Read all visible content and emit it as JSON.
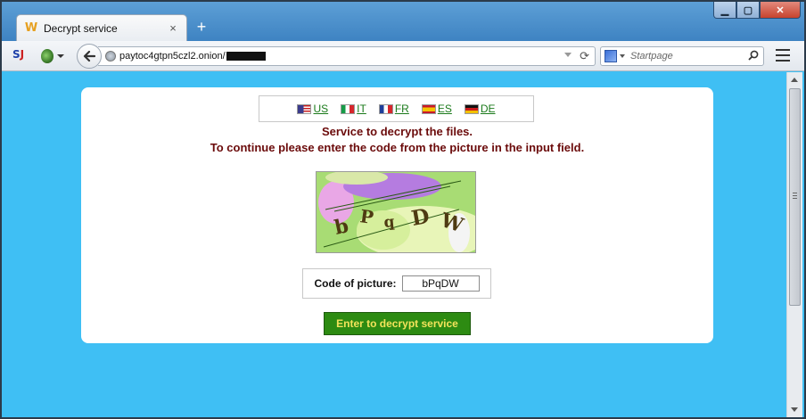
{
  "browser": {
    "tab_title": "Decrypt service",
    "url_text": "paytoc4gtpn5czl2.onion/",
    "search_placeholder": "Startpage",
    "window_controls": {
      "minimize": "▁",
      "maximize": "▢",
      "close": "✕"
    },
    "new_tab": "+",
    "tab_close": "×"
  },
  "languages": [
    {
      "code": "US",
      "flag": "us-flag-icon"
    },
    {
      "code": "IT",
      "flag": "it-flag-icon"
    },
    {
      "code": "FR",
      "flag": "fr-flag-icon"
    },
    {
      "code": "ES",
      "flag": "es-flag-icon"
    },
    {
      "code": "DE",
      "flag": "de-flag-icon"
    }
  ],
  "content": {
    "message_line1": "Service to decrypt the files.",
    "message_line2": "To continue please enter the code from the picture in the input field.",
    "captcha_text": "bPqDW",
    "code_label": "Code of picture:",
    "code_value": "bPqDW",
    "submit_label": "Enter to decrypt service"
  },
  "colors": {
    "page_background": "#3fbff4",
    "message_text": "#6b0b0b",
    "link_text": "#1a7a1a",
    "button_bg": "#2d8b12",
    "button_text": "#f3e35a"
  }
}
